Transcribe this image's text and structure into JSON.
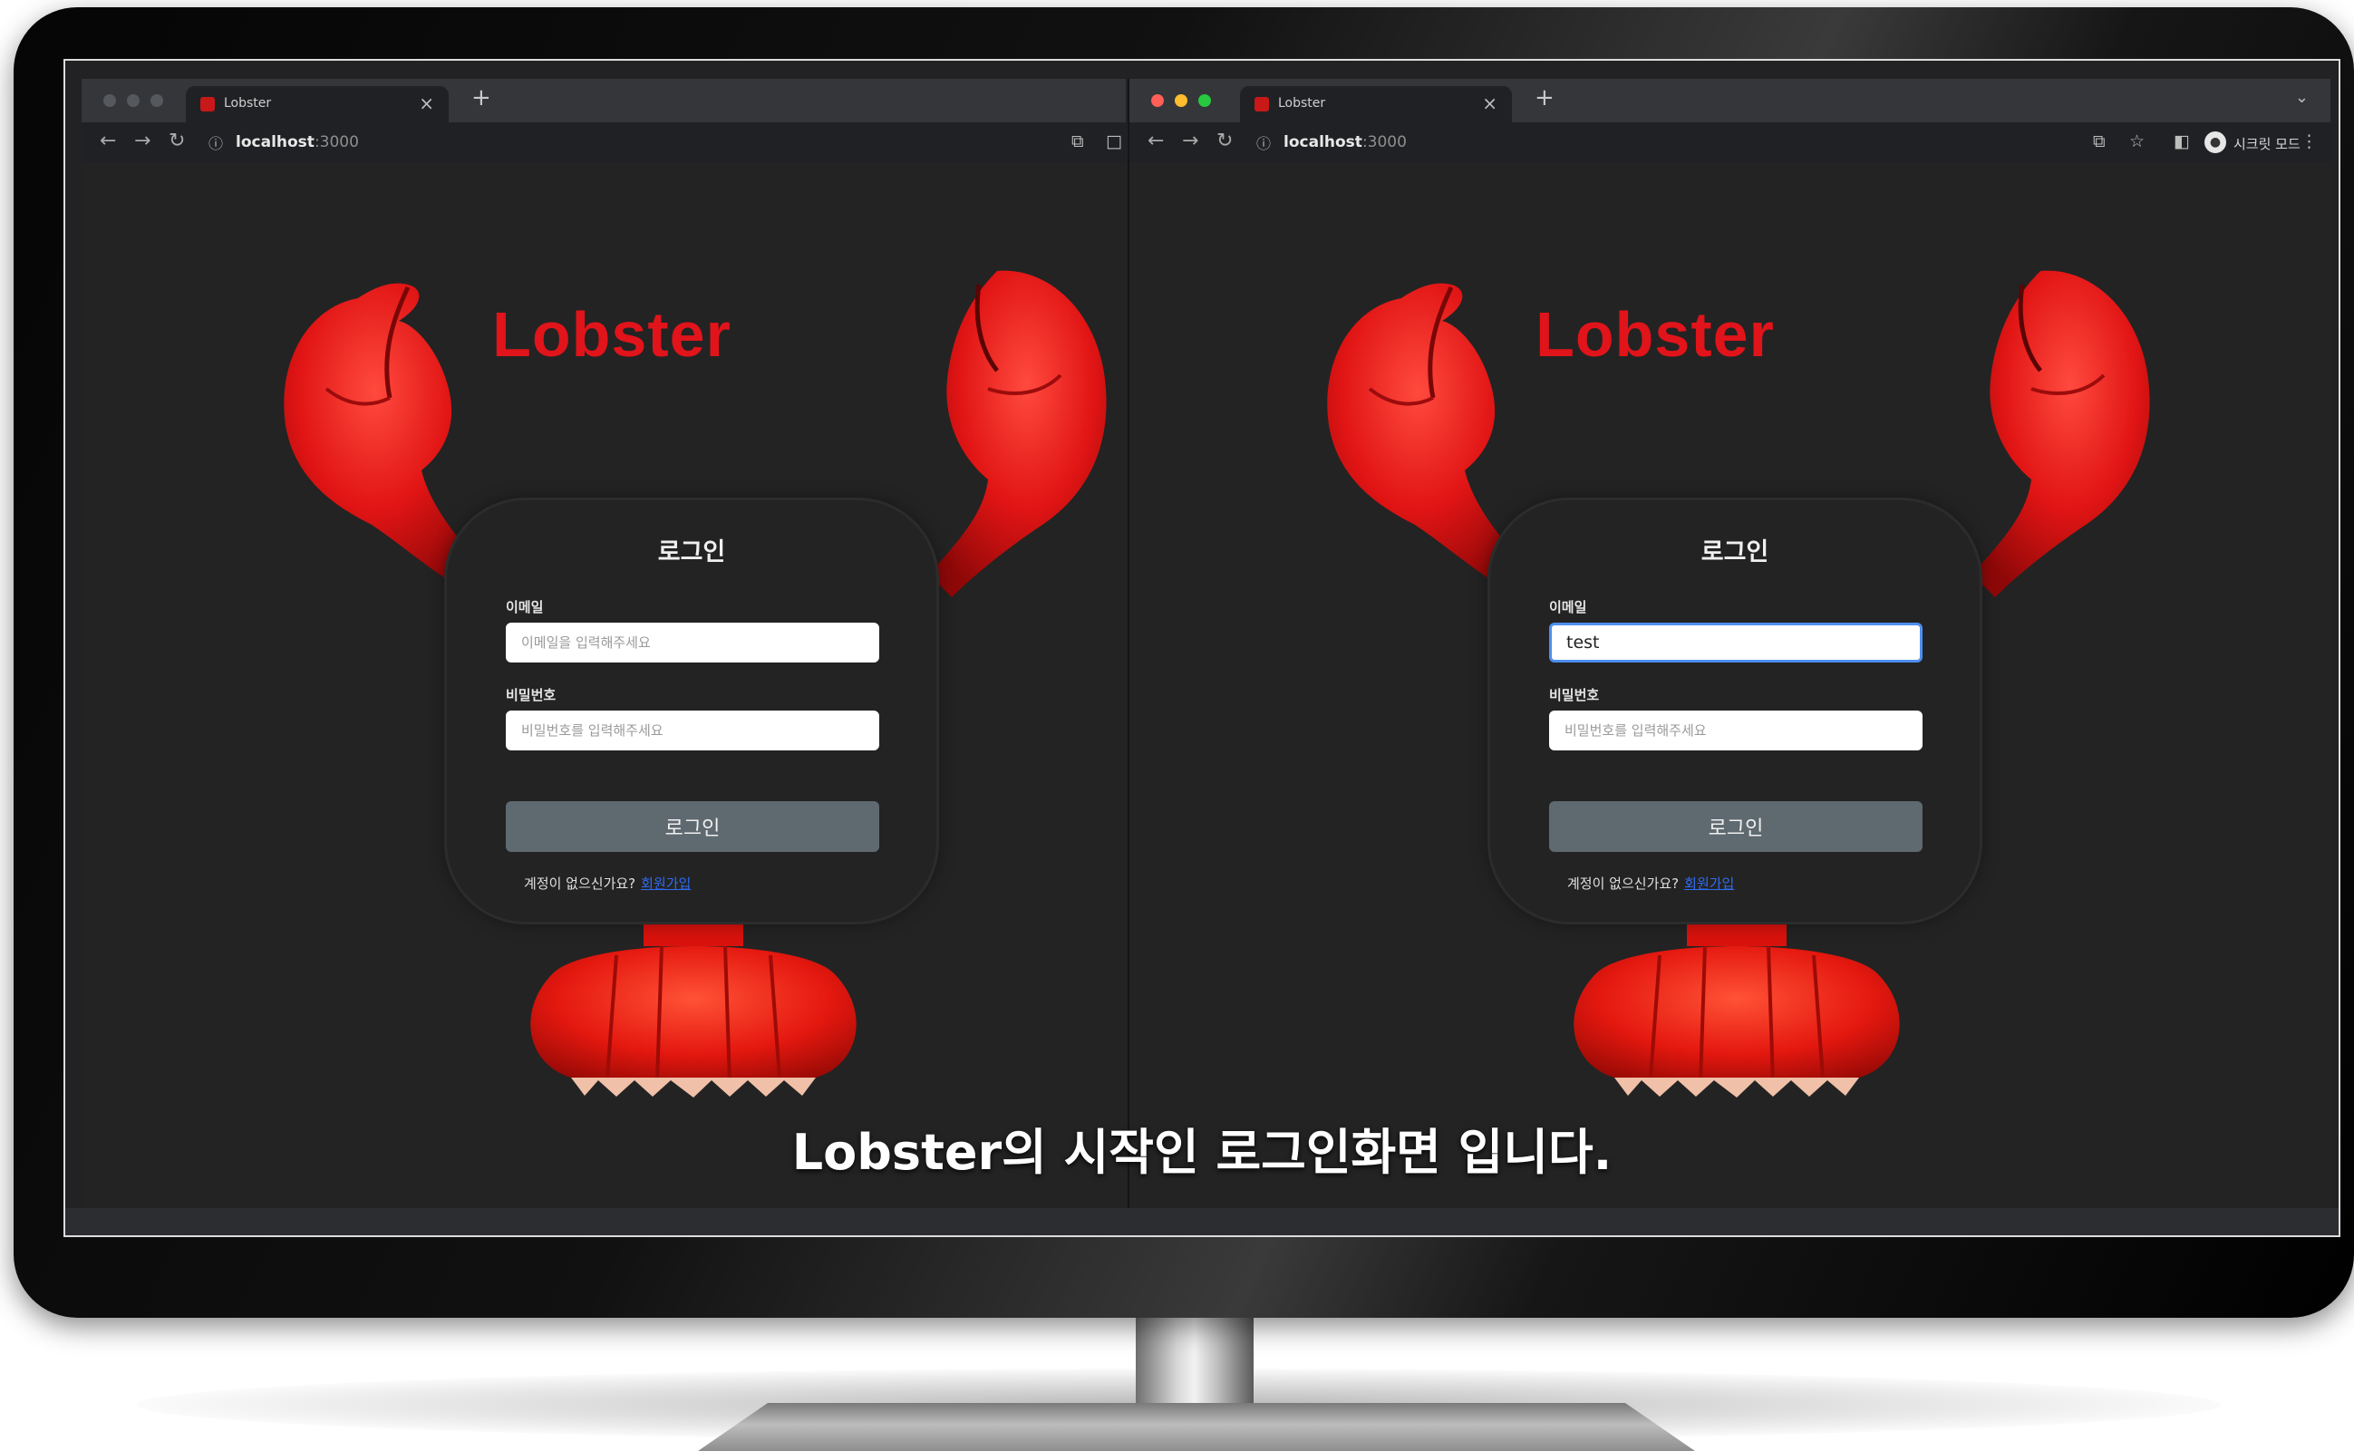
{
  "caption": "Lobster의 시작인 로그인화면 입니다.",
  "colors": {
    "brand": "#e0141a",
    "background": "#232323",
    "button": "#5f6970",
    "link": "#2f6cf5",
    "focus": "#4e8ff0"
  },
  "windows": [
    {
      "tab_title": "Lobster",
      "url_host": "localhost",
      "url_port": ":3000",
      "app_title": "Lobster",
      "login": {
        "heading": "로그인",
        "email_label": "이메일",
        "email_placeholder": "이메일을 입력해주세요",
        "email_value": "",
        "password_label": "비밀번호",
        "password_placeholder": "비밀번호를 입력해주세요",
        "submit_label": "로그인",
        "signup_prompt": "계정이 없으신가요?",
        "signup_link": "회원가입"
      }
    },
    {
      "tab_title": "Lobster",
      "url_host": "localhost",
      "url_port": ":3000",
      "profile_label": "시크릿 모드",
      "app_title": "Lobster",
      "login": {
        "heading": "로그인",
        "email_label": "이메일",
        "email_placeholder": "이메일을 입력해주세요",
        "email_value": "test",
        "password_label": "비밀번호",
        "password_placeholder": "비밀번호를 입력해주세요",
        "submit_label": "로그인",
        "signup_prompt": "계정이 없으신가요?",
        "signup_link": "회원가입"
      }
    }
  ]
}
